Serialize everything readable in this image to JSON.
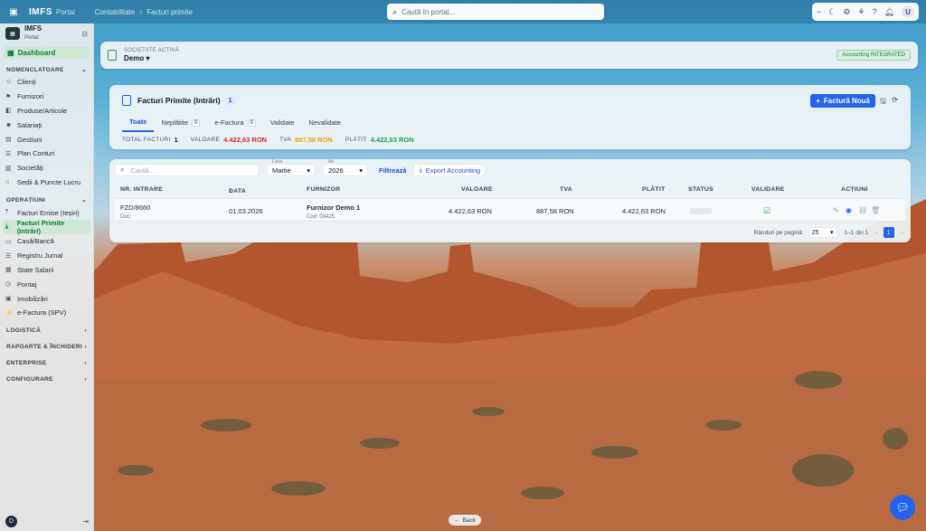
{
  "topbar": {
    "brand": "IMFS",
    "brand_suffix": "Portal",
    "crumbs": [
      "Contabilitate",
      "Facturi primite"
    ],
    "search_placeholder": "Caută în portal..."
  },
  "user": {
    "initial": "U"
  },
  "sidebar": {
    "org_name": "IMFS",
    "org_sub": "Portal",
    "dashboard": "Dashboard",
    "sections": [
      {
        "label": "NOMENCLATOARE",
        "expanded": true,
        "items": [
          "Clienți",
          "Furnizori",
          "Produse/Articole",
          "Salariați",
          "Gestiuni",
          "Plan Conturi",
          "Societăți",
          "Sedii & Puncte Lucru"
        ]
      },
      {
        "label": "OPERAȚIUNI",
        "expanded": true,
        "items": [
          "Facturi Emise (Ieșiri)",
          "Facturi Primite (Intrări)",
          "Casă/Bancă",
          "Registru Jurnal",
          "State Salarii",
          "Pontaj",
          "Imobilizări",
          "e-Factura (SPV)"
        ]
      },
      {
        "label": "LOGISTICĂ",
        "expanded": false,
        "items": []
      },
      {
        "label": "RAPOARTE & ÎNCHIDERI",
        "expanded": false,
        "items": []
      },
      {
        "label": "ENTERPRISE",
        "expanded": false,
        "items": []
      },
      {
        "label": "CONFIGURARE",
        "expanded": false,
        "items": []
      }
    ],
    "footer_initial": "D"
  },
  "company": {
    "label": "SOCIETATE ACTIVĂ",
    "value": "Demo",
    "badge": "Accounting INTEGRATED"
  },
  "invoices": {
    "title": "Facturi Primite (Intrări)",
    "count": "1",
    "add_label": "Factură Nouă",
    "tabs": [
      {
        "label": "Toate",
        "count": ""
      },
      {
        "label": "Neplătite",
        "count": "0"
      },
      {
        "label": "e-Factura",
        "count": "0"
      },
      {
        "label": "Validate",
        "count": ""
      },
      {
        "label": "Nevalidate",
        "count": ""
      }
    ],
    "stats": [
      {
        "label": "TOTAL FACTURI",
        "value": "1",
        "color": "#111827"
      },
      {
        "label": "VALOARE",
        "value": "4.422,63 RON",
        "color": "#dc2626"
      },
      {
        "label": "TVA",
        "value": "887,58 RON",
        "color": "#f59e0b"
      },
      {
        "label": "PLĂTIT",
        "value": "4.422,63 RON",
        "color": "#16a34a"
      }
    ]
  },
  "filters": {
    "search_placeholder": "Caută...",
    "month_caption": "Luna",
    "month": "Martie",
    "year_caption": "An",
    "year": "2026",
    "filter_label": "Filtrează",
    "export_label": "Export Accounting"
  },
  "table": {
    "columns": [
      "NR. INTRARE",
      "DATA",
      "FURNIZOR",
      "VALOARE",
      "TVA",
      "PLĂTIT",
      "STATUS",
      "VALIDARE",
      "ACȚIUNI"
    ],
    "rows": [
      {
        "nr": "FZD/8660",
        "nr_sub": "Doc:",
        "data": "01.03.2026",
        "furnizor": "Furnizor Demo 1",
        "furnizor_sub": "Cod: 03425",
        "valoare": "4.422,63 RON",
        "tva": "887,58 RON",
        "platit": "4.422,63 RON"
      }
    ]
  },
  "pager": {
    "per_page_label": "Rânduri pe pagină:",
    "per_page": "25",
    "range": "1–1 din 1",
    "page": "1"
  },
  "back_label": "Back",
  "colors": {
    "accent": "#2563eb",
    "success": "#16a34a"
  }
}
